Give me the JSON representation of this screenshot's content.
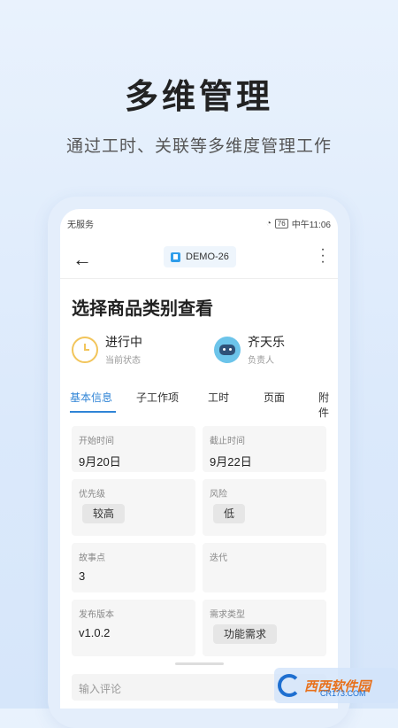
{
  "hero": {
    "title": "多维管理",
    "subtitle": "通过工时、关联等多维度管理工作"
  },
  "status_bar": {
    "left": "无服务",
    "battery": "76",
    "time": "中午11:06"
  },
  "nav": {
    "back_icon": "back-arrow-icon",
    "chip_label": "DEMO-26",
    "more_icon": "more-vertical-icon"
  },
  "task": {
    "title": "选择商品类别查看",
    "state": {
      "value": "进行中",
      "label": "当前状态"
    },
    "owner": {
      "value": "齐天乐",
      "label": "负责人"
    }
  },
  "tabs": [
    "基本信息",
    "子工作项",
    "工时",
    "页面",
    "附件"
  ],
  "active_tab": 0,
  "fields": {
    "start": {
      "label": "开始时间",
      "value": "9月20日"
    },
    "end": {
      "label": "截止时间",
      "value": "9月22日"
    },
    "priority": {
      "label": "优先级",
      "value": "较高"
    },
    "risk": {
      "label": "风险",
      "value": "低"
    },
    "points": {
      "label": "故事点",
      "value": "3"
    },
    "iteration": {
      "label": "迭代",
      "value": ""
    },
    "release": {
      "label": "发布版本",
      "value": "v1.0.2"
    },
    "req_type": {
      "label": "需求类型",
      "value": "功能需求"
    }
  },
  "comment": {
    "placeholder": "输入评论"
  },
  "watermark": {
    "brand": "西西软件园",
    "url": "CR173.COM"
  },
  "colors": {
    "accent": "#2f84d6",
    "clock": "#f2c55b",
    "chip_bg": "#eef5fc"
  }
}
